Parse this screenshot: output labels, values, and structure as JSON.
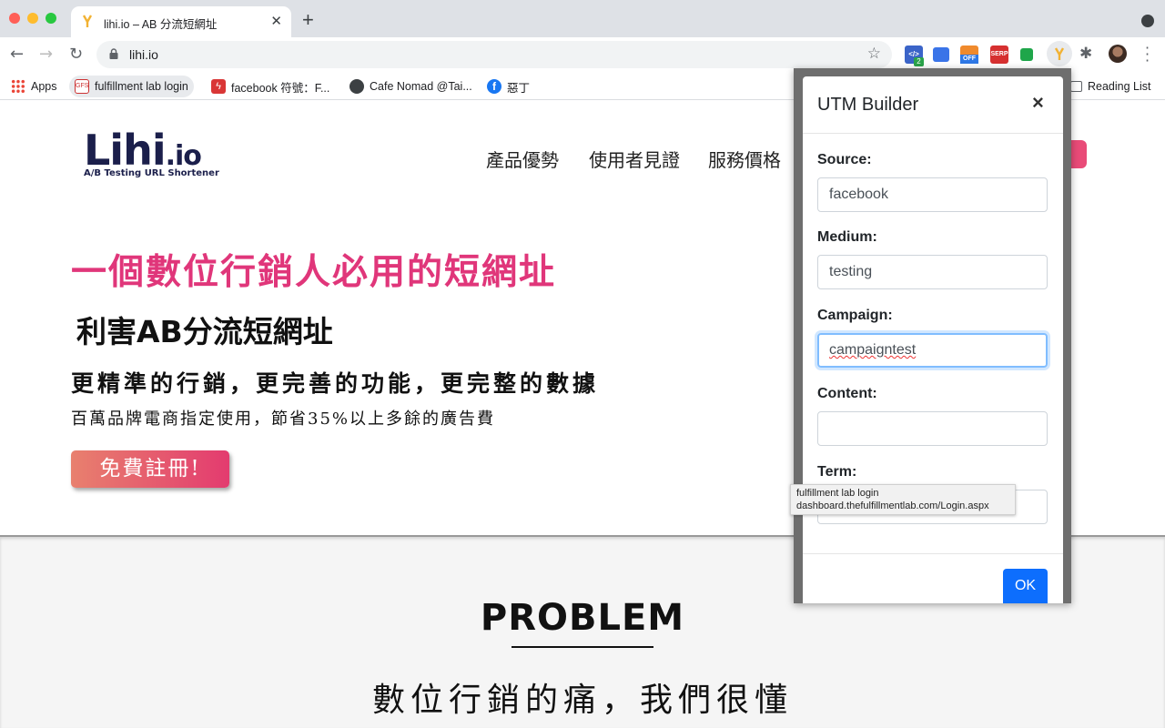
{
  "browser": {
    "tab": {
      "title": "lihi.io – AB 分流短網址",
      "close_glyph": "✕"
    },
    "new_tab_glyph": "+",
    "address": {
      "url": "lihi.io"
    },
    "bookmarks": [
      {
        "label": "Apps",
        "icon": "apps-grid-icon"
      },
      {
        "label": "fulfillment lab login",
        "icon": "gfs-icon"
      },
      {
        "label": "facebook 符號：F...",
        "icon": "bolt-icon"
      },
      {
        "label": "Cafe Nomad @Tai...",
        "icon": "globe-icon"
      },
      {
        "label": "惡丁",
        "icon": "facebook-icon"
      }
    ],
    "reading_list": "Reading List",
    "extensions": [
      {
        "icon": "code-ext-icon",
        "badge": "2",
        "color": "#3b64c8"
      },
      {
        "icon": "blue-square-ext-icon",
        "color": "#3a74e8"
      },
      {
        "icon": "off-ext-icon",
        "label": "OFF",
        "color": "#2e78e6"
      },
      {
        "icon": "serp-ext-icon",
        "label": "SERP",
        "color": "#d63030"
      },
      {
        "icon": "green-ext-icon",
        "color": "#1fa64a"
      },
      {
        "icon": "lihi-ext-icon",
        "color": "#f5c23b"
      },
      {
        "icon": "puzzle-icon",
        "color": "#5f6368"
      }
    ]
  },
  "site": {
    "logo_word": "Lihi",
    "logo_io": ".io",
    "logo_tagline": "A/B Testing URL Shortener",
    "nav": [
      "產品優勢",
      "使用者見證",
      "服務價格"
    ],
    "hero_title": "一個數位行銷人必用的短網址",
    "hero_subtitle": "利害AB分流短網址",
    "hero_line1": "更精準的行銷，更完善的功能，更完整的數據",
    "hero_line2": "百萬品牌電商指定使用，節省35%以上多餘的廣告費",
    "signup_label": "免費註冊!",
    "problem_heading": "PROBLEM",
    "problem_sub": "數位行銷的痛，我們很懂",
    "brand_color": "#e0367a"
  },
  "utm_builder": {
    "title": "UTM Builder",
    "close": "×",
    "fields": [
      {
        "label": "Source:",
        "value": "facebook"
      },
      {
        "label": "Medium:",
        "value": "testing"
      },
      {
        "label": "Campaign:",
        "value": "campaigntest"
      },
      {
        "label": "Content:",
        "value": ""
      },
      {
        "label": "Term:",
        "value": ""
      }
    ],
    "ok_label": "OK"
  },
  "tooltip": {
    "line1": "fulfillment lab login",
    "line2": "dashboard.thefulfillmentlab.com/Login.aspx"
  }
}
